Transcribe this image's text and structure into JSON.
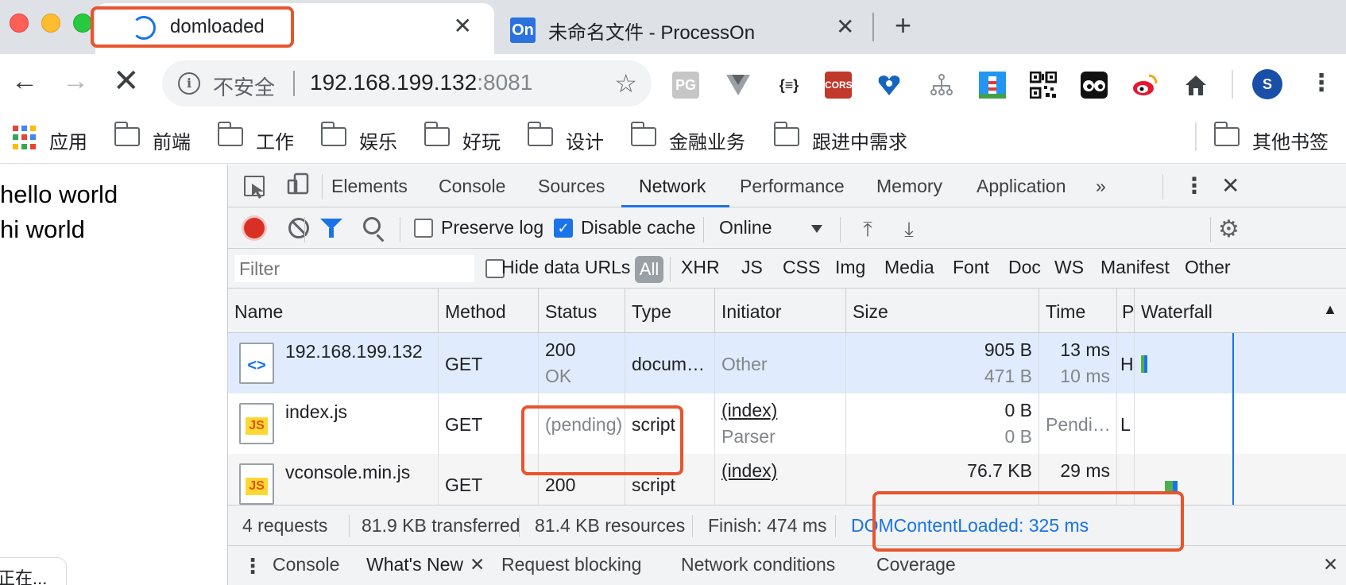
{
  "tabs": [
    {
      "title": "domloaded",
      "loading": true
    },
    {
      "title": "未命名文件 - ProcessOn",
      "favicon": "On"
    }
  ],
  "toolbar": {
    "security_label": "不安全",
    "url_host": "192.168.199.132",
    "url_port": ":8081",
    "extensions": [
      "PG",
      "vue-devtools",
      "{≡}",
      "CORS",
      "heart-icon",
      "tree-icon",
      "tower-icon",
      "qr-icon",
      "eyes-icon",
      "weibo-icon",
      "home-icon"
    ],
    "avatar_letter": "S"
  },
  "bookmarks": {
    "apps_label": "应用",
    "folders": [
      "前端",
      "工作",
      "娱乐",
      "好玩",
      "设计",
      "金融业务",
      "跟进中需求"
    ],
    "other_label": "其他书签"
  },
  "page": {
    "lines": [
      "hello world",
      "hi world"
    ],
    "status_text": "正在..."
  },
  "devtools": {
    "tabs": [
      "Elements",
      "Console",
      "Sources",
      "Network",
      "Performance",
      "Memory",
      "Application"
    ],
    "active_tab": "Network",
    "more_label": "»",
    "toolbar": {
      "preserve_log_label": "Preserve log",
      "preserve_log_checked": false,
      "disable_cache_label": "Disable cache",
      "disable_cache_checked": true,
      "throttle_value": "Online"
    },
    "filter": {
      "placeholder": "Filter",
      "hide_data_urls_label": "Hide data URLs",
      "all_label": "All",
      "types": [
        "XHR",
        "JS",
        "CSS",
        "Img",
        "Media",
        "Font",
        "Doc",
        "WS",
        "Manifest",
        "Other"
      ]
    },
    "columns": [
      "Name",
      "Method",
      "Status",
      "Type",
      "Initiator",
      "Size",
      "Time",
      "P",
      "Waterfall"
    ],
    "rows": [
      {
        "name": "192.168.199.132",
        "method": "GET",
        "status": "200",
        "status_text": "OK",
        "type": "docum…",
        "initiator": "Other",
        "initiator_sub": "",
        "size": "905 B",
        "size_sub": "471 B",
        "time": "13 ms",
        "time_sub": "10 ms",
        "priority": "H",
        "icon": "<>"
      },
      {
        "name": "index.js",
        "method": "GET",
        "status": "(pending)",
        "status_text": "",
        "type": "script",
        "initiator": "(index)",
        "initiator_sub": "Parser",
        "size": "0 B",
        "size_sub": "0 B",
        "time": "Pendi…",
        "time_sub": "",
        "priority": "L",
        "icon": "JS"
      },
      {
        "name": "vconsole.min.js",
        "method": "GET",
        "status": "200",
        "status_text": "",
        "type": "script",
        "initiator": "(index)",
        "initiator_sub": "",
        "size": "76.7 KB",
        "size_sub": "",
        "time": "29 ms",
        "time_sub": "",
        "priority": "",
        "icon": "JS"
      }
    ],
    "summary": {
      "requests": "4 requests",
      "transferred": "81.9 KB transferred",
      "resources": "81.4 KB resources",
      "finish": "Finish: 474 ms",
      "dom_content_loaded": "DOMContentLoaded: 325 ms"
    },
    "drawer_tabs": [
      "Console",
      "What's New",
      "Request blocking",
      "Network conditions",
      "Coverage"
    ],
    "drawer_active": "What's New"
  },
  "colors": {
    "accent": "#1a73e8",
    "highlight_box": "#e8542e",
    "record_red": "#d93025",
    "selected_row": "#e0ecfd"
  }
}
